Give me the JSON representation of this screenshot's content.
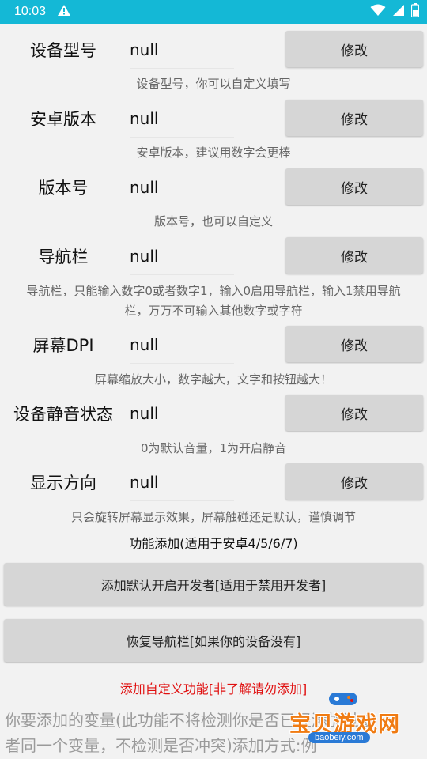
{
  "status_bar": {
    "time": "10:03",
    "icons": [
      "warning-icon",
      "wifi-icon",
      "cell-signal-icon",
      "battery-icon"
    ]
  },
  "settings": [
    {
      "label": "设备型号",
      "value": "null",
      "button": "修改",
      "desc": "设备型号，你可以自定义填写"
    },
    {
      "label": "安卓版本",
      "value": "null",
      "button": "修改",
      "desc": "安卓版本，建议用数字会更棒"
    },
    {
      "label": "版本号",
      "value": "null",
      "button": "修改",
      "desc": "版本号，也可以自定义"
    },
    {
      "label": "导航栏",
      "value": "null",
      "button": "修改",
      "desc_line1": "导航栏，只能输入数字0或者数字1，输入0启用导航栏，输入1禁用导航",
      "desc_line2": "栏，万万不可输入其他数字或字符"
    },
    {
      "label": "屏幕DPI",
      "value": "null",
      "button": "修改",
      "desc": "屏幕缩放大小，数字越大，文字和按钮越大！"
    },
    {
      "label": "设备静音状态",
      "value": "null",
      "button": "修改",
      "desc": "0为默认音量，1为开启静音"
    },
    {
      "label": "显示方向",
      "value": "null",
      "button": "修改",
      "desc": "只会旋转屏幕显示效果，屏幕触碰还是默认，谨慎调节"
    }
  ],
  "features": {
    "title": "功能添加(适用于安卓4/5/6/7)",
    "enable_dev_button": "添加默认开启开发者[适用于禁用开发者]",
    "restore_nav_button": "恢复导航栏[如果你的设备没有]",
    "warning": "添加自定义功能[非了解请勿添加]",
    "help_line1": "你要添加的变量(此功能不将检测你是否已经添加过或",
    "help_line2": "者同一个变量，不检测是否冲突)添加方式:例"
  },
  "watermark": {
    "brand": "宝贝游戏网",
    "url": "baobeiy.com"
  },
  "colors": {
    "status_bar": "#14b8d6",
    "button_bg": "#d6d6d6",
    "warning_text": "#e01010",
    "watermark_brand": "#f07b12"
  }
}
